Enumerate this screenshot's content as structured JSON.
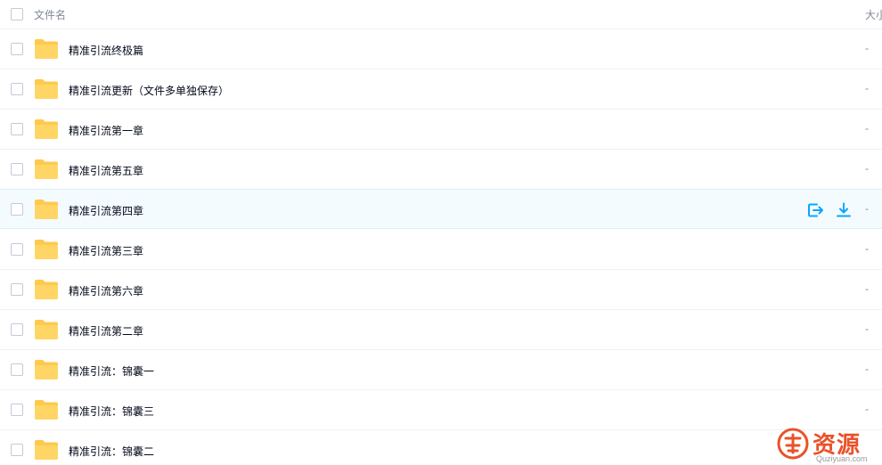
{
  "header": {
    "name_col": "文件名",
    "size_col": "大小"
  },
  "files": [
    {
      "name": "精准引流终极篇",
      "size": "-"
    },
    {
      "name": "精准引流更新（文件多单独保存）",
      "size": "-"
    },
    {
      "name": "精准引流第一章",
      "size": "-"
    },
    {
      "name": "精准引流第五章",
      "size": "-"
    },
    {
      "name": "精准引流第四章",
      "size": "-"
    },
    {
      "name": "精准引流第三章",
      "size": "-"
    },
    {
      "name": "精准引流第六章",
      "size": "-"
    },
    {
      "name": "精准引流第二章",
      "size": "-"
    },
    {
      "name": "精准引流：锦囊一",
      "size": "-"
    },
    {
      "name": "精准引流：锦囊三",
      "size": "-"
    },
    {
      "name": "精准引流：锦囊二",
      "size": "-"
    }
  ],
  "hover_actions": {
    "share_icon": "share-icon",
    "download_icon": "download-icon"
  },
  "watermark": {
    "title": "资源",
    "sub": "Quziyuan.com"
  },
  "colors": {
    "folder": "#ffc94d",
    "accent": "#06a7ff",
    "watermark": "#e9522a"
  }
}
